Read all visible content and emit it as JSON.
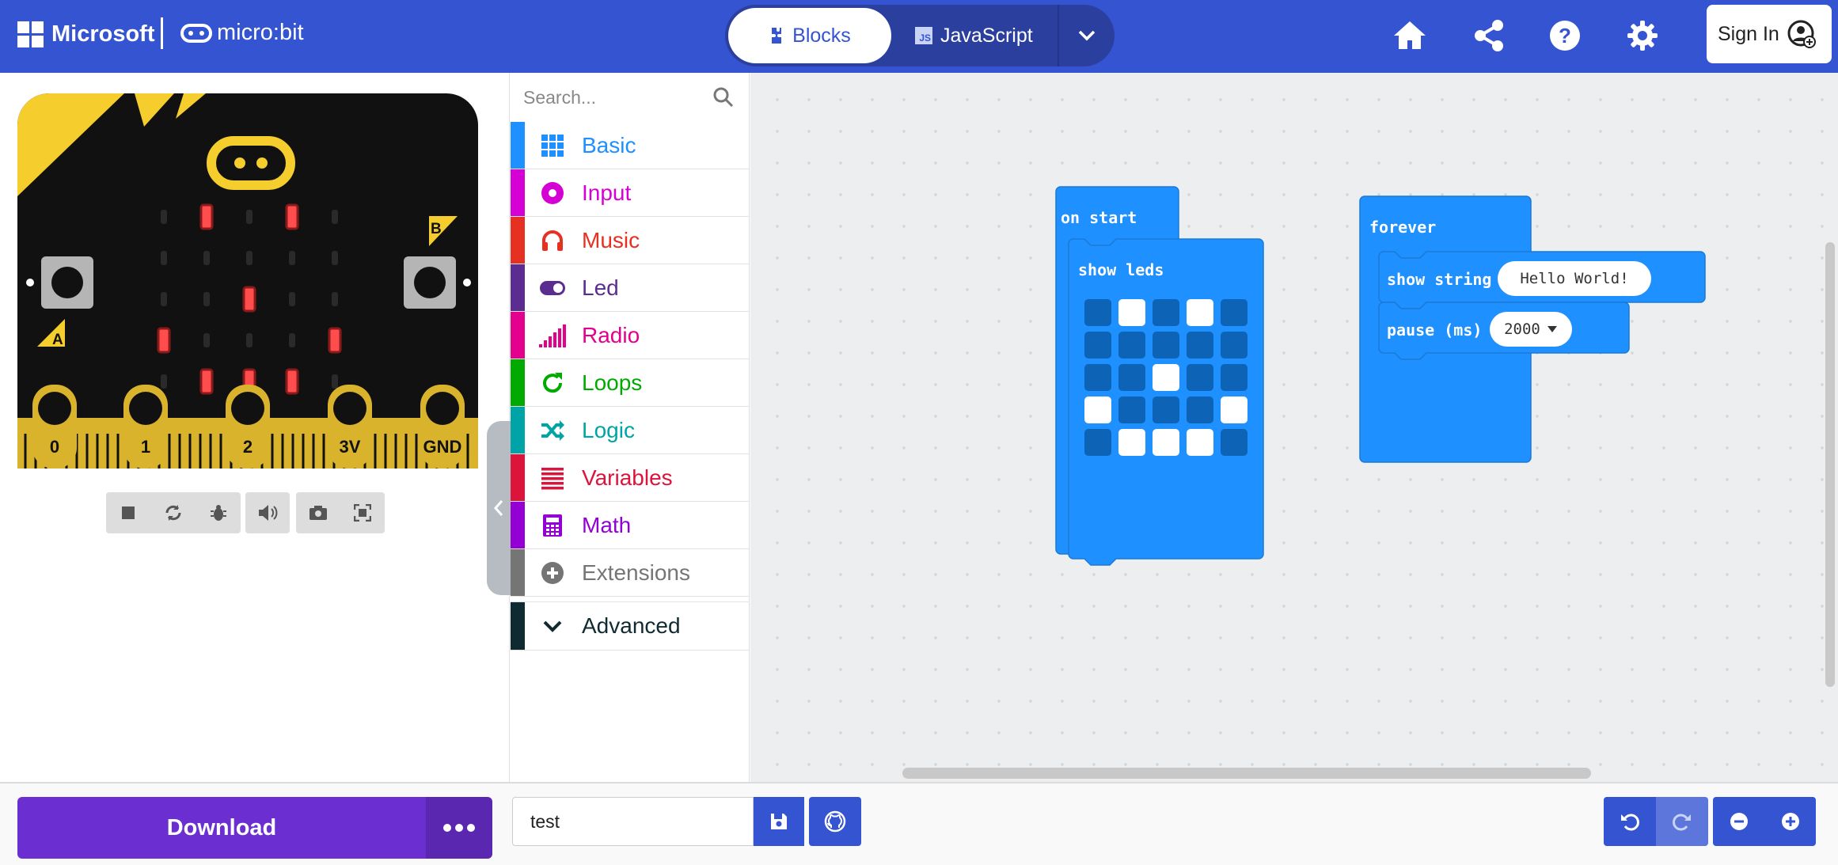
{
  "header": {
    "brand": "Microsoft",
    "product": "micro:bit",
    "toggle_blocks": "Blocks",
    "toggle_javascript": "JavaScript",
    "js_badge": "JS",
    "signin_label": "Sign In",
    "icons": [
      "home-icon",
      "share-icon",
      "help-icon",
      "settings-icon"
    ]
  },
  "simulator": {
    "pins": [
      "0",
      "1",
      "2",
      "3V",
      "GND"
    ],
    "button_a": "A",
    "button_b": "B",
    "controls": [
      "stop-icon",
      "restart-icon",
      "debug-icon",
      "mute-icon",
      "screenshot-icon",
      "fullscreen-icon"
    ]
  },
  "toolbox": {
    "search_placeholder": "Search...",
    "categories": [
      {
        "label": "Basic",
        "color": "#1e90ff",
        "icon": "grid-icon"
      },
      {
        "label": "Input",
        "color": "#d400d4",
        "icon": "input-circle-icon"
      },
      {
        "label": "Music",
        "color": "#e63022",
        "icon": "headphones-icon"
      },
      {
        "label": "Led",
        "color": "#5c2d91",
        "icon": "toggle-icon"
      },
      {
        "label": "Radio",
        "color": "#e3008c",
        "icon": "signal-bars-icon"
      },
      {
        "label": "Loops",
        "color": "#00aa00",
        "icon": "refresh-icon"
      },
      {
        "label": "Logic",
        "color": "#00a4a6",
        "icon": "shuffle-icon"
      },
      {
        "label": "Variables",
        "color": "#dc143c",
        "icon": "lines-icon"
      },
      {
        "label": "Math",
        "color": "#9400d3",
        "icon": "calculator-icon"
      },
      {
        "label": "Extensions",
        "color": "#757575",
        "icon": "plus-circle-icon"
      }
    ],
    "advanced_label": "Advanced"
  },
  "workspace": {
    "on_start_label": "on start",
    "show_leds_label": "show leds",
    "leds": [
      [
        0,
        1,
        0,
        1,
        0
      ],
      [
        0,
        0,
        0,
        0,
        0
      ],
      [
        0,
        0,
        1,
        0,
        0
      ],
      [
        1,
        0,
        0,
        0,
        1
      ],
      [
        0,
        1,
        1,
        1,
        0
      ]
    ],
    "forever_label": "forever",
    "show_string_label": "show string",
    "string_value": "Hello World!",
    "pause_label": "pause (ms)",
    "pause_value": "2000"
  },
  "footer": {
    "download_label": "Download",
    "project_name": "test"
  },
  "colors": {
    "header": "#3454d1",
    "block_blue": "#1e90ff",
    "download": "#6b2fd1"
  }
}
